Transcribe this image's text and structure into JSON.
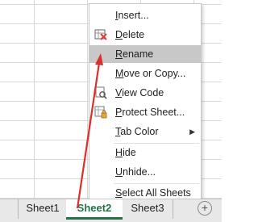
{
  "sheet_tabs": [
    {
      "label": "Sheet1",
      "active": false
    },
    {
      "label": "Sheet2",
      "active": true
    },
    {
      "label": "Sheet3",
      "active": false
    }
  ],
  "add_sheet_icon": "plus-circle-icon",
  "context_menu": {
    "items": [
      {
        "label": "Insert...",
        "icon": "none"
      },
      {
        "label": "Delete",
        "icon": "delete-sheet-icon"
      },
      {
        "label": "Rename",
        "icon": "none",
        "highlighted": true
      },
      {
        "label": "Move or Copy...",
        "icon": "none"
      },
      {
        "label": "View Code",
        "icon": "view-code-icon"
      },
      {
        "label": "Protect Sheet...",
        "icon": "protect-sheet-icon"
      },
      {
        "label": "Tab Color",
        "icon": "none",
        "submenu": true
      },
      {
        "label": "Hide",
        "icon": "none"
      },
      {
        "label": "Unhide...",
        "icon": "none"
      },
      {
        "label": "Select All Sheets",
        "icon": "none"
      }
    ]
  },
  "colors": {
    "active_tab_text": "#217346",
    "highlight": "#c8c8c8",
    "annotation_arrow": "#d9302c",
    "delete_icon_mark": "#e23b2e"
  }
}
